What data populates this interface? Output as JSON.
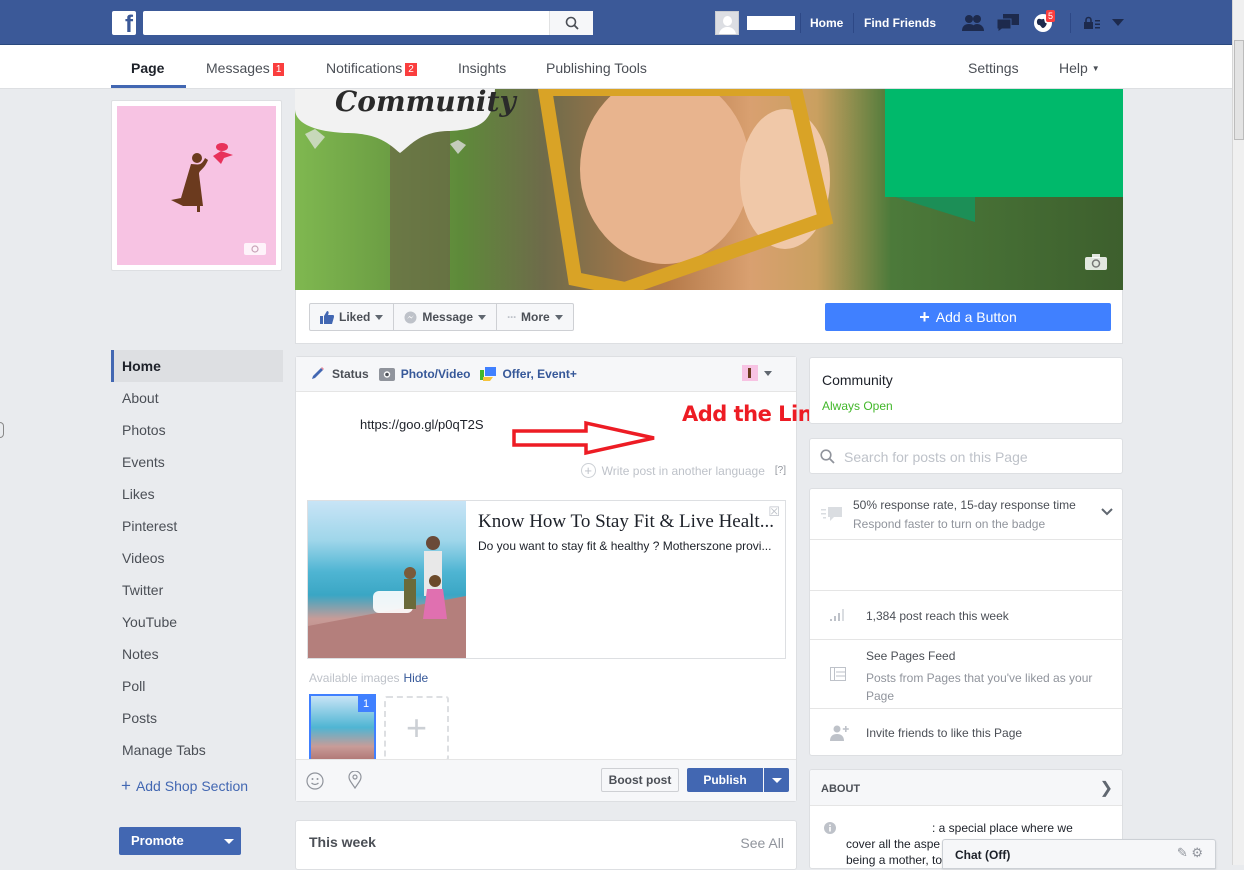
{
  "topbar": {
    "logo": "f",
    "search_placeholder": "",
    "nav_links": [
      "Home",
      "Find Friends"
    ],
    "notifications_count": "5",
    "icons": [
      "friend-requests-icon",
      "messages-icon",
      "globe-notifications-icon",
      "privacy-shortcuts-icon",
      "account-menu-icon"
    ]
  },
  "subnav": {
    "tabs": [
      {
        "label": "Page",
        "active": true
      },
      {
        "label": "Messages",
        "count": "1"
      },
      {
        "label": "Notifications",
        "count": "2"
      },
      {
        "label": "Insights"
      },
      {
        "label": "Publishing Tools"
      }
    ],
    "right": {
      "settings": "Settings",
      "help": "Help"
    }
  },
  "cover": {
    "banner_text": "Community"
  },
  "actions": {
    "liked": "Liked",
    "message": "Message",
    "more": "More",
    "add_button": "Add a Button"
  },
  "leftnav": {
    "items": [
      "Home",
      "About",
      "Photos",
      "Events",
      "Likes",
      "Pinterest",
      "Videos",
      "Twitter",
      "YouTube",
      "Notes",
      "Poll",
      "Posts",
      "Manage Tabs"
    ],
    "active": "Home",
    "add_shop": "Add Shop Section",
    "promote": "Promote"
  },
  "composer": {
    "tabs": [
      "Status",
      "Photo/Video",
      "Offer, Event+"
    ],
    "text": "https://goo.gl/p0qT2S",
    "write_lang": "Write post in another language",
    "help": "[?]",
    "preview": {
      "title": "Know How To Stay Fit & Live Healt...",
      "description": "Do you want to stay fit & healthy ? Motherszone provi..."
    },
    "available_images": "Available images",
    "hide": "Hide",
    "selected_image_number": "1",
    "boost": "Boost post",
    "publish": "Publish"
  },
  "annotation": {
    "text": "Add the Link",
    "color": "#ed1c24"
  },
  "thisweek": {
    "title": "This week",
    "see_all": "See All"
  },
  "rightcol": {
    "category": "Community",
    "hours": "Always Open",
    "search_placeholder": "Search for posts on this Page",
    "response": {
      "line1": "50% response rate, 15-day response time",
      "line2": "Respond faster to turn on the badge"
    },
    "reach": "1,384 post reach this week",
    "pages_feed": {
      "title": "See Pages Feed",
      "sub": "Posts from Pages that you've liked as your Page"
    },
    "invite": "Invite friends to like this Page",
    "about": {
      "header": "ABOUT",
      "text_line1": ": a special place where we",
      "text_line2": "cover all the aspe",
      "text_line3": "being a mother, to"
    }
  },
  "chat": {
    "label": "Chat (Off)"
  },
  "colors": {
    "brand": "#3b5998",
    "accent": "#4267b2",
    "add_button": "#4080ff",
    "badge": "#fa3e3e",
    "open_green": "#42b72a"
  }
}
